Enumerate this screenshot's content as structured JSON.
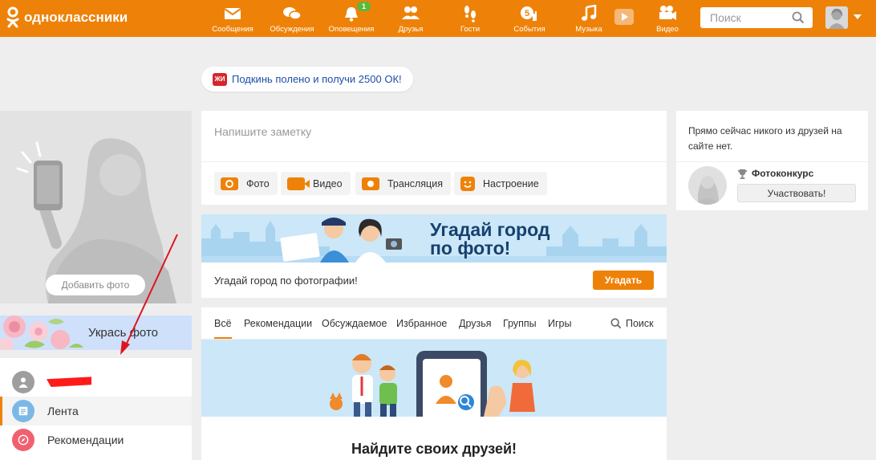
{
  "header": {
    "brand": "одноклассники",
    "nav": [
      {
        "label": "Сообщения",
        "icon": "envelope-icon"
      },
      {
        "label": "Обсуждения",
        "icon": "chat-bubbles-icon"
      },
      {
        "label": "Оповещения",
        "icon": "bell-icon",
        "badge": "1"
      },
      {
        "label": "Друзья",
        "icon": "friends-icon"
      },
      {
        "label": "Гости",
        "icon": "footprints-icon"
      },
      {
        "label": "События",
        "icon": "events-like-icon",
        "badge_inline": "5"
      },
      {
        "label": "Музыка",
        "icon": "music-note-icon"
      },
      {
        "label": "Видео",
        "icon": "video-camera-icon"
      }
    ],
    "search_placeholder": "Поиск"
  },
  "promo": {
    "icon_text": "ЖИ",
    "text": "Подкинь полено и получи 2500 ОК!"
  },
  "left": {
    "add_photo": "Добавить фото",
    "decorate": "Укрась фото",
    "menu": [
      {
        "label": "",
        "icon": "user-icon"
      },
      {
        "label": "Лента",
        "icon": "feed-icon"
      },
      {
        "label": "Рекомендации",
        "icon": "compass-icon"
      }
    ]
  },
  "note": {
    "placeholder": "Напишите заметку",
    "actions": [
      "Фото",
      "Видео",
      "Трансляция",
      "Настроение"
    ]
  },
  "game": {
    "title_line1": "Угадай город",
    "title_line2": "по фото!",
    "subtitle": "Угадай город по фотографии!",
    "button": "Угадать"
  },
  "feed": {
    "tabs": [
      "Всё",
      "Рекомендации",
      "Обсуждаемое",
      "Избранное",
      "Друзья",
      "Группы",
      "Игры"
    ],
    "search": "Поиск",
    "find_title": "Найдите своих друзей!"
  },
  "right": {
    "online_text": "Прямо сейчас никого из друзей на сайте нет.",
    "contest_title": "Фотоконкурс",
    "contest_button": "Участвовать!"
  },
  "colors": {
    "brand": "#ee8208",
    "page_bg": "#eeeeee",
    "link": "#1d4ea8",
    "badge": "#5cb83a",
    "annotation": "#e0141e"
  }
}
